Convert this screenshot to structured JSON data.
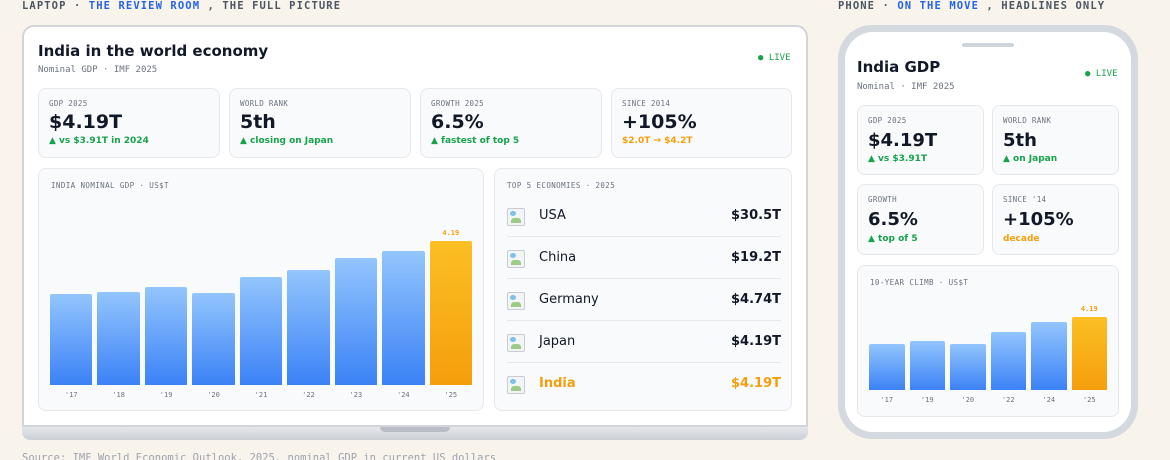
{
  "captions": {
    "laptop": {
      "prefix": "LAPTOP · ",
      "highlight": "THE REVIEW ROOM",
      "suffix": " , THE FULL PICTURE"
    },
    "phone": {
      "prefix": "PHONE · ",
      "highlight": "ON THE MOVE",
      "suffix": " , HEADLINES ONLY"
    }
  },
  "footer": "Source: IMF World Economic Outlook, 2025. nominal GDP in current US dollars",
  "colors": {
    "accent_blue": "#3b82f6",
    "highlight_orange": "#f59e0b",
    "positive_green": "#16a34a"
  },
  "laptop": {
    "title": "India in the world economy",
    "subtitle": "Nominal GDP · IMF 2025",
    "live": "● LIVE",
    "kpis": [
      {
        "label": "GDP 2025",
        "value": "$4.19T",
        "note": "▲ vs $3.91T in 2024",
        "tone": "green"
      },
      {
        "label": "WORLD RANK",
        "value": "5th",
        "note": "▲ closing on Japan",
        "tone": "green"
      },
      {
        "label": "GROWTH 2025",
        "value": "6.5%",
        "note": "▲ fastest of top 5",
        "tone": "green"
      },
      {
        "label": "SINCE 2014",
        "value": "+105%",
        "note": "$2.0T → $4.2T",
        "tone": "orange"
      }
    ],
    "chart_label": "INDIA NOMINAL GDP · US$T",
    "economies_label": "TOP 5 ECONOMIES · 2025",
    "economies": [
      {
        "name": "USA",
        "value": "$30.5T"
      },
      {
        "name": "China",
        "value": "$19.2T"
      },
      {
        "name": "Germany",
        "value": "$4.74T"
      },
      {
        "name": "Japan",
        "value": "$4.19T"
      },
      {
        "name": "India",
        "value": "$4.19T"
      }
    ]
  },
  "phone": {
    "title": "India GDP",
    "subtitle": "Nominal · IMF 2025",
    "live": "● LIVE",
    "kpis": [
      {
        "label": "GDP 2025",
        "value": "$4.19T",
        "note": "▲ vs $3.91T",
        "tone": "green"
      },
      {
        "label": "WORLD RANK",
        "value": "5th",
        "note": "▲ on Japan",
        "tone": "green"
      },
      {
        "label": "GROWTH",
        "value": "6.5%",
        "note": "▲ top of 5",
        "tone": "green"
      },
      {
        "label": "SINCE '14",
        "value": "+105%",
        "note": "decade",
        "tone": "orange"
      }
    ],
    "chart_label": "10-YEAR CLIMB · US$T"
  },
  "chart_data": [
    {
      "type": "bar",
      "title": "INDIA NOMINAL GDP · US$T",
      "categories": [
        "'17",
        "'18",
        "'19",
        "'20",
        "'21",
        "'22",
        "'23",
        "'24",
        "'25"
      ],
      "values": [
        2.65,
        2.7,
        2.84,
        2.67,
        3.15,
        3.35,
        3.7,
        3.91,
        4.19
      ],
      "data_labels": {
        "8": "4.19"
      },
      "highlight_index": 8,
      "ylim": [
        0,
        4.6
      ]
    },
    {
      "type": "bar",
      "title": "10-YEAR CLIMB · US$T",
      "categories": [
        "'17",
        "'19",
        "'20",
        "'22",
        "'24",
        "'25"
      ],
      "values": [
        2.65,
        2.84,
        2.67,
        3.35,
        3.91,
        4.19
      ],
      "data_labels": {
        "5": "4.19"
      },
      "highlight_index": 5,
      "ylim": [
        0,
        4.6
      ]
    }
  ]
}
